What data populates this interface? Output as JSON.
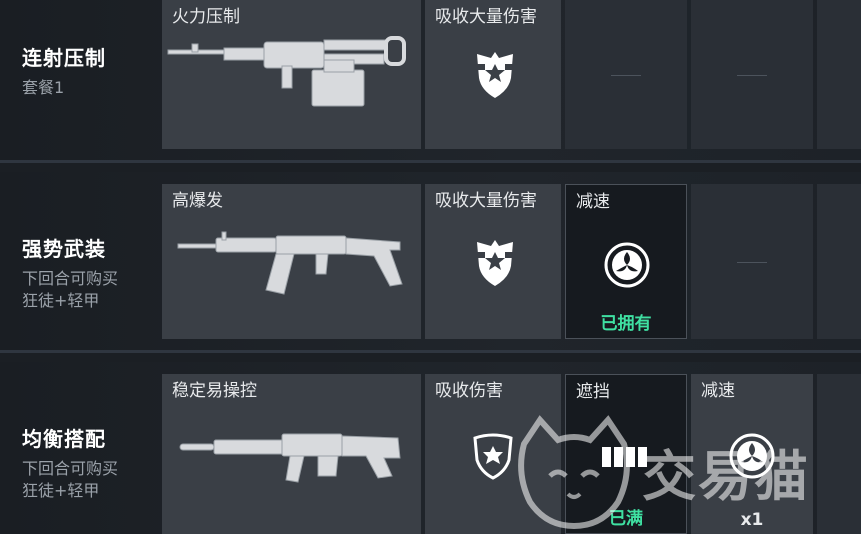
{
  "loadouts": [
    {
      "title": "连射压制",
      "subtitle": [
        "套餐1"
      ],
      "weapon": {
        "title": "火力压制"
      },
      "armor": {
        "title": "吸收大量伤害"
      },
      "extras": []
    },
    {
      "title": "强势武装",
      "subtitle": [
        "下回合可购买",
        "狂徒+轻甲"
      ],
      "weapon": {
        "title": "高爆发"
      },
      "armor": {
        "title": "吸收大量伤害"
      },
      "extras": [
        {
          "title": "减速",
          "status": "已拥有"
        }
      ]
    },
    {
      "title": "均衡搭配",
      "subtitle": [
        "下回合可购买",
        "狂徒+轻甲"
      ],
      "weapon": {
        "title": "稳定易操控"
      },
      "armor": {
        "title": "吸收伤害"
      },
      "extras": [
        {
          "title": "遮挡",
          "status": "已满"
        },
        {
          "title": "减速",
          "count": "x1"
        }
      ]
    }
  ],
  "watermark": {
    "text": "交易猫"
  },
  "colors": {
    "status_green": "#3fe0a2",
    "card": "#3a3f46",
    "card_dark": "#161a1f"
  }
}
